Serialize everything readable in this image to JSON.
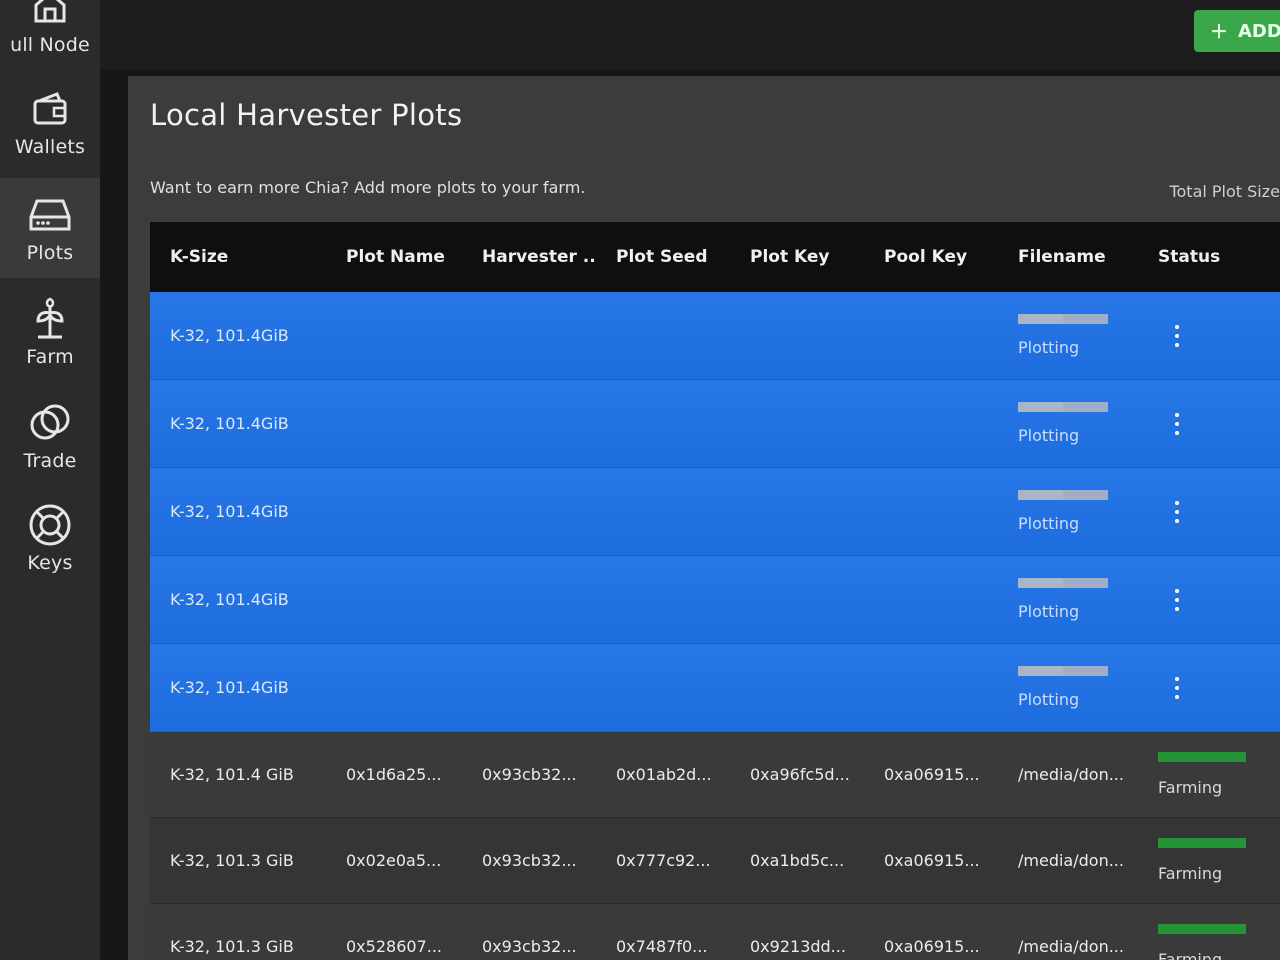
{
  "sidebar": {
    "items": [
      {
        "label": "ull Node",
        "icon": "home-icon",
        "active": false
      },
      {
        "label": "Wallets",
        "icon": "wallet-icon",
        "active": false
      },
      {
        "label": "Plots",
        "icon": "hard-drive-icon",
        "active": true
      },
      {
        "label": "Farm",
        "icon": "sprout-icon",
        "active": false
      },
      {
        "label": "Trade",
        "icon": "trade-icon",
        "active": false
      },
      {
        "label": "Keys",
        "icon": "lifebuoy-icon",
        "active": false
      }
    ]
  },
  "topbar": {
    "add_label": "ADD"
  },
  "page": {
    "title": "Local Harvester Plots",
    "subtitle": "Want to earn more Chia? Add more plots to your farm.",
    "total_plot_size_label": "Total Plot Size"
  },
  "table": {
    "headers": [
      "K-Size",
      "Plot Name",
      "Harvester ...",
      "Plot Seed",
      "Plot Key",
      "Pool Key",
      "Filename",
      "Status"
    ],
    "plotting_rows": [
      {
        "ksize": "K-32, 101.4GiB",
        "status": "Plotting",
        "progress": 0.5
      },
      {
        "ksize": "K-32, 101.4GiB",
        "status": "Plotting",
        "progress": 0.5
      },
      {
        "ksize": "K-32, 101.4GiB",
        "status": "Plotting",
        "progress": 0.5
      },
      {
        "ksize": "K-32, 101.4GiB",
        "status": "Plotting",
        "progress": 0.5
      },
      {
        "ksize": "K-32, 101.4GiB",
        "status": "Plotting",
        "progress": 0.5
      }
    ],
    "farming_rows": [
      {
        "ksize": "K-32, 101.4 GiB",
        "name": "0x1d6a25...",
        "harvester": "0x93cb32...",
        "seed": "0x01ab2d...",
        "key": "0xa96fc5d...",
        "pool": "0xa06915...",
        "file": "/media/don...",
        "status": "Farming"
      },
      {
        "ksize": "K-32, 101.3 GiB",
        "name": "0x02e0a5...",
        "harvester": "0x93cb32...",
        "seed": "0x777c92...",
        "key": "0xa1bd5c...",
        "pool": "0xa06915...",
        "file": "/media/don...",
        "status": "Farming"
      },
      {
        "ksize": "K-32, 101.3 GiB",
        "name": "0x528607...",
        "harvester": "0x93cb32...",
        "seed": "0x7487f0...",
        "key": "0x9213dd...",
        "pool": "0xa06915...",
        "file": "/media/don...",
        "status": "Farming"
      }
    ]
  },
  "colors": {
    "plotting_row": "#1f71e6",
    "farming_bar": "#249437",
    "add_button": "#3aa84a"
  }
}
